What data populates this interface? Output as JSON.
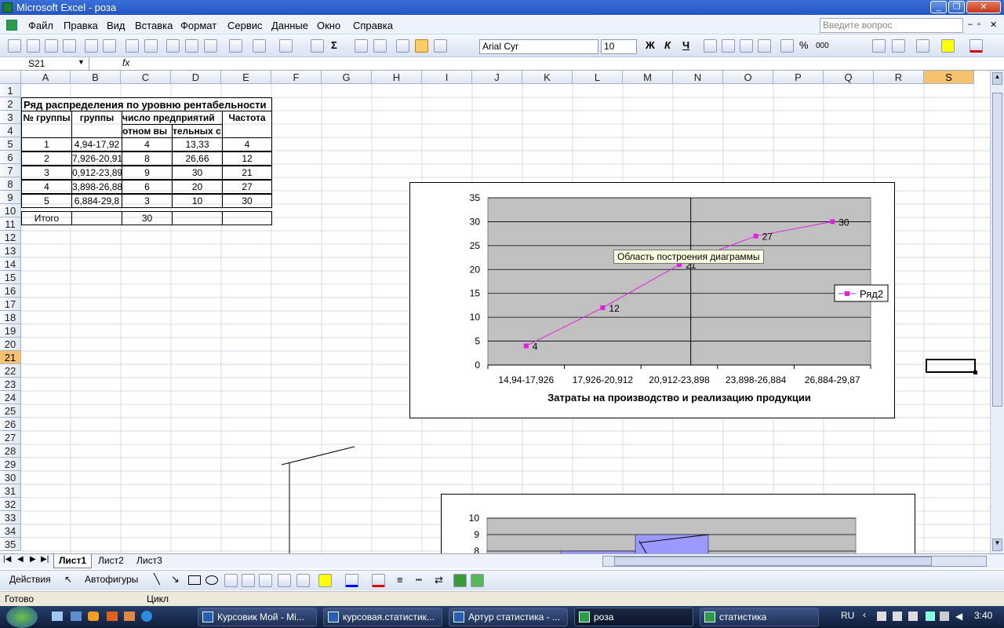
{
  "window": {
    "title": "Microsoft Excel - роза"
  },
  "menu": [
    "Файл",
    "Правка",
    "Вид",
    "Вставка",
    "Формат",
    "Сервис",
    "Данные",
    "Окно",
    "Справка"
  ],
  "help_placeholder": "Введите вопрос",
  "toolbar": {
    "font": "Arial Cyr",
    "size": "10",
    "bold": "Ж",
    "italic": "К",
    "underline": "Ч",
    "percent": "%",
    "thousands": "000",
    "sum": "Σ"
  },
  "formula_bar": {
    "cell_ref": "S21",
    "fx": "fx",
    "value": ""
  },
  "columns": [
    "A",
    "B",
    "C",
    "D",
    "E",
    "F",
    "G",
    "H",
    "I",
    "J",
    "K",
    "L",
    "M",
    "N",
    "O",
    "P",
    "Q",
    "R",
    "S"
  ],
  "rows": [
    "1",
    "2",
    "3",
    "4",
    "5",
    "6",
    "7",
    "8",
    "9",
    "10",
    "11",
    "12",
    "13",
    "14",
    "15",
    "16",
    "17",
    "18",
    "19",
    "20",
    "21",
    "22",
    "23",
    "24",
    "25",
    "26",
    "27",
    "28",
    "29",
    "30",
    "31",
    "32",
    "33",
    "34",
    "35"
  ],
  "table": {
    "title": "Ряд распределения по уровню рентабельности",
    "h_a": "№ группы",
    "h_b": "группы",
    "h_c1": "число предприятий",
    "h_c2": "отном вы",
    "h_d2": "тельных с",
    "h_e": "Частота",
    "rows": [
      {
        "a": "1",
        "b": "4,94-17,92",
        "c": "4",
        "d": "13,33",
        "e": "4"
      },
      {
        "a": "2",
        "b": "7,926-20,91",
        "c": "8",
        "d": "26,66",
        "e": "12"
      },
      {
        "a": "3",
        "b": "0,912-23,89",
        "c": "9",
        "d": "30",
        "e": "21"
      },
      {
        "a": "4",
        "b": "3,898-26,88",
        "c": "6",
        "d": "20",
        "e": "27"
      },
      {
        "a": "5",
        "b": "6,884-29,8",
        "c": "3",
        "d": "10",
        "e": "30"
      }
    ],
    "total_label": "Итого",
    "total_c": "30"
  },
  "chart_tooltip": "Область построения диаграммы",
  "chart_data": [
    {
      "type": "line",
      "categories": [
        "14,94-17,926",
        "17,926-20,912",
        "20,912-23,898",
        "23,898-26,884",
        "26,884-29,87"
      ],
      "series": [
        {
          "name": "Ряд2",
          "values": [
            4,
            12,
            21,
            27,
            30
          ],
          "color": "#e020e0"
        }
      ],
      "data_labels": [
        "4",
        "12",
        "21",
        "27",
        "30"
      ],
      "xlabel": "Затраты на производство и реализацию продукции",
      "ylim": [
        0,
        35
      ],
      "yticks": [
        "0",
        "5",
        "10",
        "15",
        "20",
        "25",
        "30",
        "35"
      ],
      "grid": true,
      "legend": "right",
      "plot_bg": "#c0c0c0"
    },
    {
      "type": "bar",
      "yticks": [
        "8",
        "9",
        "10"
      ],
      "ylim": [
        8,
        10
      ],
      "bar_color": "#9999ff",
      "plot_bg": "#c0c0c0"
    }
  ],
  "sheets": [
    "Лист1",
    "Лист2",
    "Лист3"
  ],
  "drawing": {
    "actions": "Действия",
    "autoshapes": "Автофигуры"
  },
  "status": {
    "ready": "Готово",
    "mode": "Цикл"
  },
  "taskbar": {
    "items": [
      "Курсовик Мой - Mi...",
      "курсовая.статистик...",
      "Артур статистика - ...",
      "роза",
      "статистика"
    ],
    "lang": "RU",
    "time": "3:40"
  },
  "colors": {
    "accent": "#3a6fd8",
    "selected_header": "#f7c26e",
    "series": "#e020e0"
  }
}
